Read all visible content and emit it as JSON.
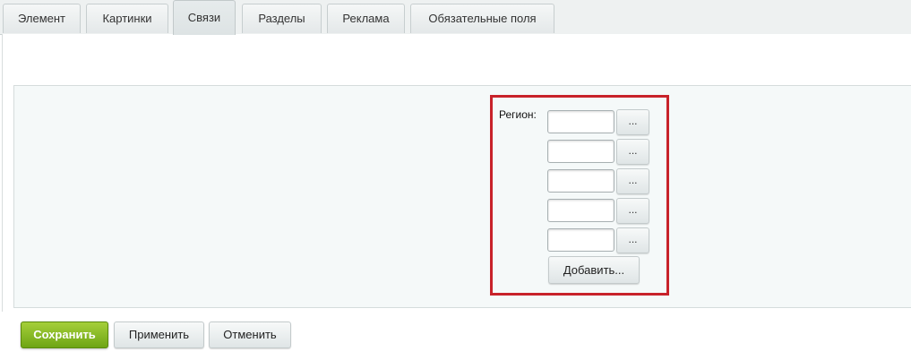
{
  "tabs": [
    {
      "label": "Элемент",
      "active": false
    },
    {
      "label": "Картинки",
      "active": false
    },
    {
      "label": "Связи",
      "active": true
    },
    {
      "label": "Разделы",
      "active": false
    },
    {
      "label": "Реклама",
      "active": false
    },
    {
      "label": "Обязательные поля",
      "active": false
    }
  ],
  "region_field": {
    "label": "Регион:",
    "inputs": [
      {
        "value": "",
        "browse_label": "..."
      },
      {
        "value": "",
        "browse_label": "..."
      },
      {
        "value": "",
        "browse_label": "..."
      },
      {
        "value": "",
        "browse_label": "..."
      },
      {
        "value": "",
        "browse_label": "..."
      }
    ],
    "add_label": "Добавить..."
  },
  "footer": {
    "save_label": "Сохранить",
    "apply_label": "Применить",
    "cancel_label": "Отменить"
  },
  "colors": {
    "highlight_border": "#c8222a",
    "save_button": "#7fb51f"
  }
}
